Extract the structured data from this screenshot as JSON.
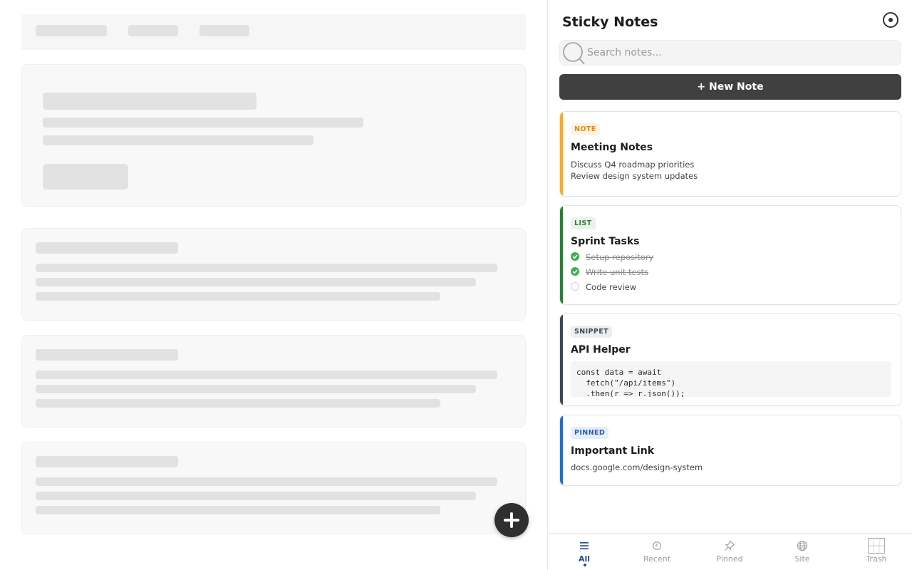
{
  "panel": {
    "title": "Sticky Notes",
    "settings_icon": "settings-circle-icon"
  },
  "search": {
    "placeholder": "Search notes...",
    "icon": "search-icon"
  },
  "new_note_button": "+ New Note",
  "notes": [
    {
      "type": "NOTE",
      "accent": "#f2a93b",
      "badge_bg": "#fdf3e2",
      "badge_fg": "#e08b12",
      "title": "Meeting Notes",
      "lines": [
        "Discuss Q4 roadmap priorities",
        "Review design system updates"
      ]
    },
    {
      "type": "LIST",
      "accent": "#2f7d3d",
      "badge_bg": "#e8f3ea",
      "badge_fg": "#2f7d3d",
      "title": "Sprint Tasks",
      "tasks": [
        {
          "label": "Setup repository",
          "done": true
        },
        {
          "label": "Write unit tests",
          "done": true
        },
        {
          "label": "Code review",
          "done": false
        }
      ]
    },
    {
      "type": "SNIPPET",
      "accent": "#3d4a52",
      "badge_bg": "#eceff1",
      "badge_fg": "#3d4a52",
      "title": "API Helper",
      "code": "const data = await\n  fetch(\"/api/items\")\n  .then(r => r.json());"
    },
    {
      "type": "PINNED",
      "accent": "#2b6cc4",
      "badge_bg": "#e6eefb",
      "badge_fg": "#2b5ea8",
      "title": "Important Link",
      "link": "docs.google.com/design-system"
    }
  ],
  "bottom_nav": [
    {
      "label": "All",
      "icon": "list-icon",
      "active": true
    },
    {
      "label": "Recent",
      "icon": "clock-icon",
      "active": false
    },
    {
      "label": "Pinned",
      "icon": "pin-icon",
      "active": false
    },
    {
      "label": "Site",
      "icon": "globe-icon",
      "active": false
    },
    {
      "label": "Trash",
      "icon": "trash-icon",
      "active": false
    }
  ],
  "fab": {
    "icon": "plus-icon"
  }
}
